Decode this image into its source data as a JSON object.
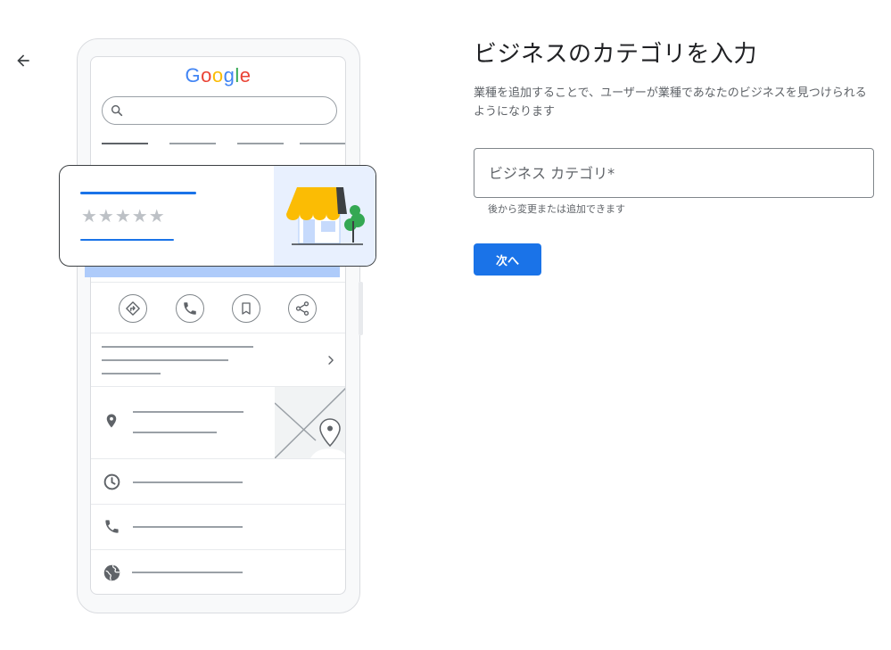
{
  "nav": {
    "back_icon": "arrow-back-icon"
  },
  "content": {
    "title": "ビジネスのカテゴリを入力",
    "subtitle": "業種を追加することで、ユーザーが業種であなたのビジネスを見つけられるようになります",
    "category_field": {
      "placeholder": "ビジネス カテゴリ*",
      "value": ""
    },
    "helper_text": "後から変更または追加できます",
    "next_button": "次へ"
  },
  "illustration": {
    "logo_letters": [
      {
        "char": "G",
        "color": "#4285F4"
      },
      {
        "char": "o",
        "color": "#EA4335"
      },
      {
        "char": "o",
        "color": "#FBBC05"
      },
      {
        "char": "g",
        "color": "#4285F4"
      },
      {
        "char": "l",
        "color": "#34A853"
      },
      {
        "char": "e",
        "color": "#EA4335"
      }
    ],
    "rating_stars": "★★★★★",
    "action_icons": [
      "directions-icon",
      "phone-icon",
      "bookmark-icon",
      "share-icon"
    ],
    "colors": {
      "accent": "#1a73e8",
      "awning": "#FBBC04",
      "tree": "#34A853",
      "panel": "#e8f0fe"
    }
  }
}
